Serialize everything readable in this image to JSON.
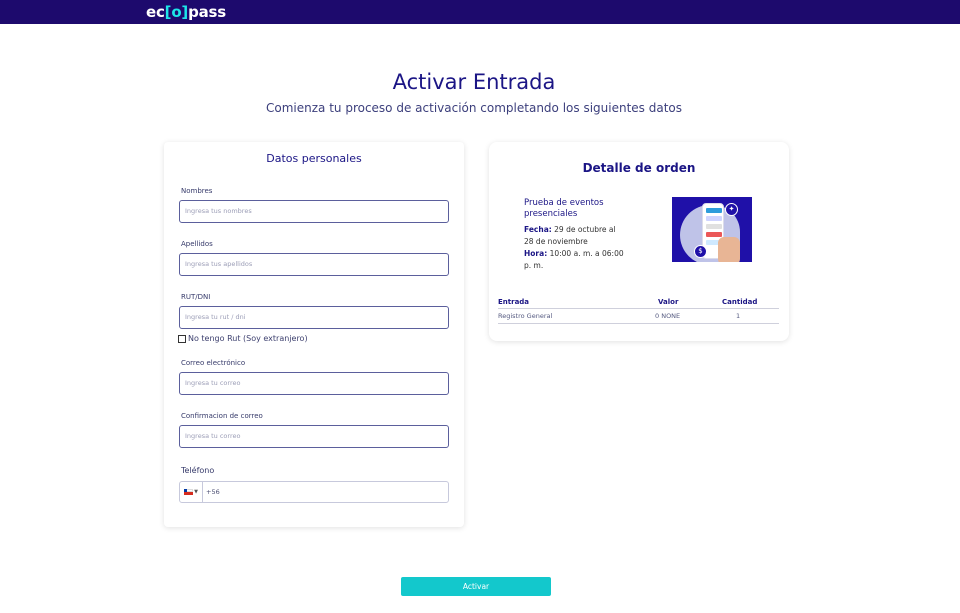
{
  "brand": {
    "logo_left": "ec",
    "logo_mid": "[o]",
    "logo_right": "pass",
    "bar_color": "#1d0a6d",
    "accent": "#1de5e8"
  },
  "page": {
    "title": "Activar Entrada",
    "subtitle": "Comienza tu proceso de activación completando los siguientes datos"
  },
  "personal": {
    "title": "Datos personales",
    "fields": [
      {
        "label": "Nombres",
        "placeholder": "Ingresa tus nombres"
      },
      {
        "label": "Apellidos",
        "placeholder": "Ingresa tus apellidos"
      },
      {
        "label": "RUT/DNI",
        "placeholder": "Ingresa tu rut / dni"
      },
      {
        "label": "Correo electrónico",
        "placeholder": "Ingresa tu correo"
      },
      {
        "label": "Confirmacion de correo",
        "placeholder": "Ingresa tu correo"
      }
    ],
    "no_rut_label": "No tengo Rut (Soy extranjero)",
    "phone_label": "Teléfono",
    "phone_code": "+56",
    "phone_flag_icon": "chile-flag-icon"
  },
  "order": {
    "title": "Detalle de orden",
    "event_name": "Prueba de eventos presenciales",
    "date_label": "Fecha:",
    "date_value": "29 de octubre al 28 de noviembre",
    "time_label": "Hora:",
    "time_value": "10:00 a. m. a 06:00 p. m.",
    "table": {
      "headers": [
        "Entrada",
        "Valor",
        "Cantidad"
      ],
      "rows": [
        [
          "Registro General",
          "0 NONE",
          "1"
        ]
      ]
    }
  },
  "actions": {
    "activate_label": "Activar",
    "activate_color": "#13c8cc"
  }
}
